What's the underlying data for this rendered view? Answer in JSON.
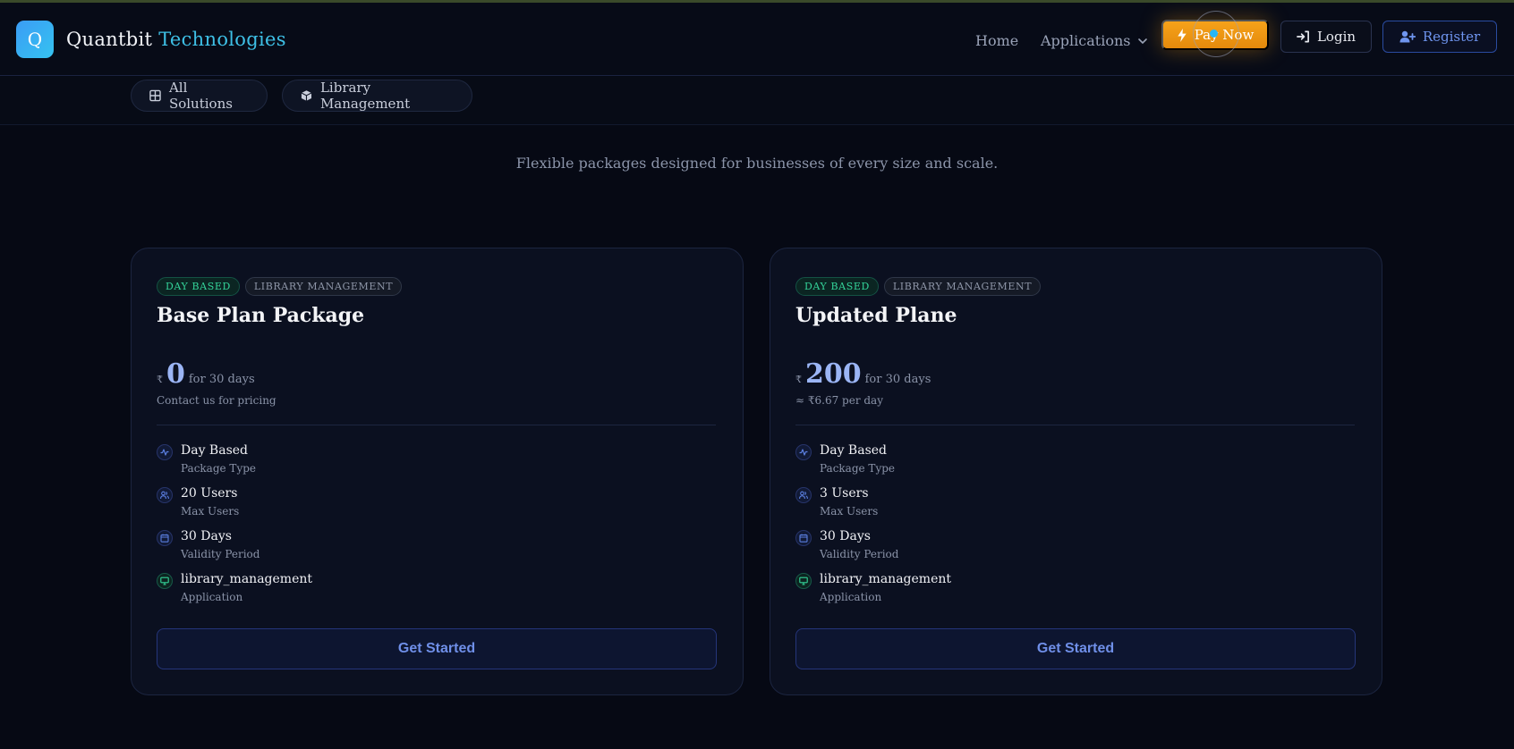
{
  "header": {
    "logo_letter": "Q",
    "brand_word1": "Quantbit",
    "brand_word2": "Technologies",
    "nav_home": "Home",
    "nav_applications": "Applications",
    "pay_now": "Pay Now",
    "login": "Login",
    "register": "Register"
  },
  "subnav": {
    "all_solutions": "All Solutions",
    "library_management": "Library Management"
  },
  "tagline": "Flexible packages designed for businesses of every size and scale.",
  "plans": [
    {
      "badge_type": "DAY BASED",
      "badge_app": "LIBRARY MANAGEMENT",
      "title": "Base Plan Package",
      "currency": "₹",
      "amount": "0",
      "period": "for 30 days",
      "note": "Contact us for pricing",
      "features": [
        {
          "icon": "activity-icon",
          "value": "Day Based",
          "label": "Package Type"
        },
        {
          "icon": "users-icon",
          "value": "20 Users",
          "label": "Max Users"
        },
        {
          "icon": "calendar-icon",
          "value": "30 Days",
          "label": "Validity Period"
        },
        {
          "icon": "monitor-icon",
          "value": "library_management",
          "label": "Application"
        }
      ],
      "cta": "Get Started"
    },
    {
      "badge_type": "DAY BASED",
      "badge_app": "LIBRARY MANAGEMENT",
      "title": "Updated Plane",
      "currency": "₹",
      "amount": "200",
      "period": "for 30 days",
      "note": "≈ ₹6.67 per day",
      "features": [
        {
          "icon": "activity-icon",
          "value": "Day Based",
          "label": "Package Type"
        },
        {
          "icon": "users-icon",
          "value": "3 Users",
          "label": "Max Users"
        },
        {
          "icon": "calendar-icon",
          "value": "30 Days",
          "label": "Validity Period"
        },
        {
          "icon": "monitor-icon",
          "value": "library_management",
          "label": "Application"
        }
      ],
      "cta": "Get Started"
    }
  ],
  "colors": {
    "background": "#060914",
    "accent_cyan": "#3ec0e6",
    "accent_orange": "#f59e0b",
    "accent_blue": "#6f95ef",
    "badge_green": "#34d399"
  }
}
